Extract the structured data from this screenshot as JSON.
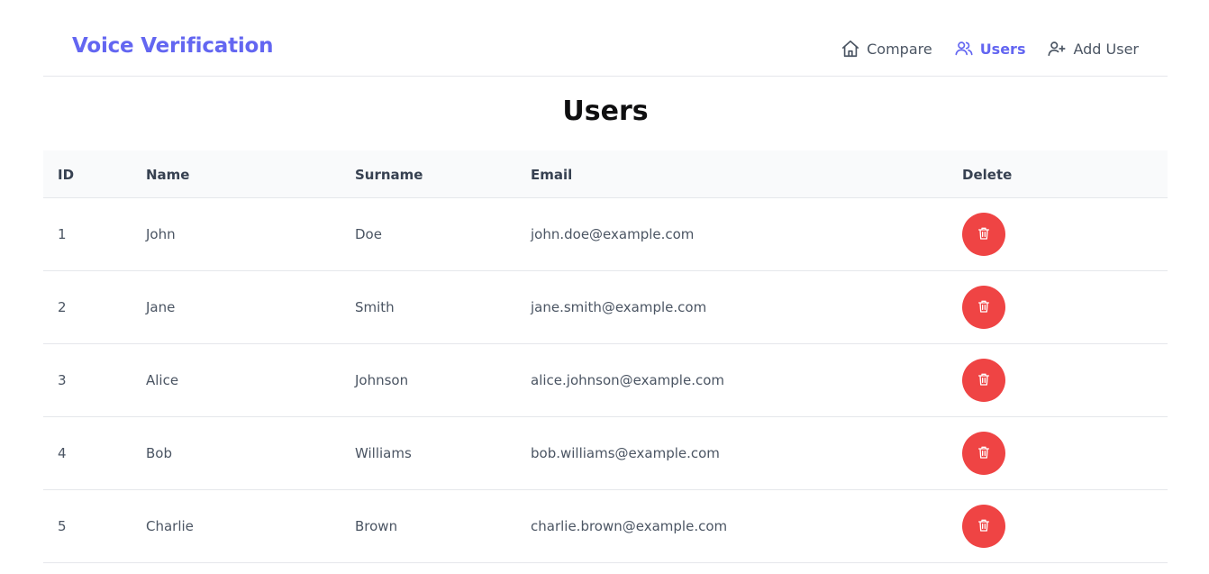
{
  "header": {
    "brand": "Voice Verification",
    "nav": [
      {
        "label": "Compare",
        "icon": "home-icon",
        "active": false
      },
      {
        "label": "Users",
        "icon": "users-icon",
        "active": true
      },
      {
        "label": "Add User",
        "icon": "user-plus-icon",
        "active": false
      }
    ]
  },
  "page": {
    "title": "Users"
  },
  "table": {
    "columns": [
      "ID",
      "Name",
      "Surname",
      "Email",
      "Delete"
    ],
    "rows": [
      {
        "id": "1",
        "name": "John",
        "surname": "Doe",
        "email": "john.doe@example.com"
      },
      {
        "id": "2",
        "name": "Jane",
        "surname": "Smith",
        "email": "jane.smith@example.com"
      },
      {
        "id": "3",
        "name": "Alice",
        "surname": "Johnson",
        "email": "alice.johnson@example.com"
      },
      {
        "id": "4",
        "name": "Bob",
        "surname": "Williams",
        "email": "bob.williams@example.com"
      },
      {
        "id": "5",
        "name": "Charlie",
        "surname": "Brown",
        "email": "charlie.brown@example.com"
      }
    ],
    "delete_icon": "trash-icon"
  },
  "colors": {
    "accent": "#6366f1",
    "danger": "#ef4444",
    "header_bg": "#f9fafb",
    "border": "#e5e7eb"
  }
}
